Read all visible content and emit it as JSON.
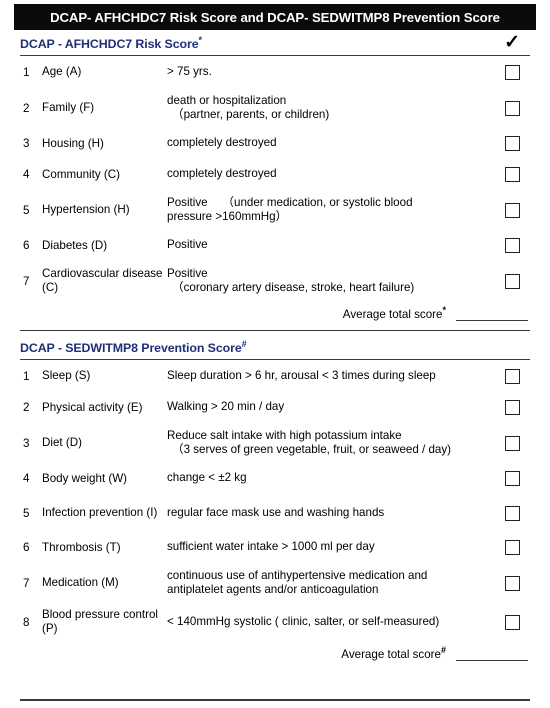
{
  "header": {
    "title": "DCAP- AFHCHDC7 Risk Score and DCAP- SEDWITMP8 Prevention Score"
  },
  "sections": [
    {
      "id": "risk",
      "title": "DCAP - AFHCHDC7 Risk Score",
      "marker": "*",
      "check_icon": "✓",
      "rows": [
        {
          "num": "1",
          "label": "Age (A)",
          "desc_line1": "> 75 yrs.",
          "desc_line2": ""
        },
        {
          "num": "2",
          "label": "Family  (F)",
          "desc_line1": "death or hospitalization",
          "desc_line2": "（partner, parents, or children)"
        },
        {
          "num": "3",
          "label": "Housing  (H)",
          "desc_line1": "completely destroyed",
          "desc_line2": ""
        },
        {
          "num": "4",
          "label": "Community (C)",
          "desc_line1": "completely destroyed",
          "desc_line2": ""
        },
        {
          "num": "5",
          "label": "Hypertension  (H)",
          "desc_line1": "Positive　 （under medication, or systolic blood",
          "desc_line2": "pressure  >160mmHg）"
        },
        {
          "num": "6",
          "label": "Diabetes  (D)",
          "desc_line1": "Positive",
          "desc_line2": ""
        },
        {
          "num": "7",
          "label": "Cardiovascular disease (C)",
          "desc_line1": "Positive",
          "desc_line2": "（coronary artery disease, stroke, heart failure)"
        }
      ],
      "average": {
        "label": "Average total score",
        "marker": "*",
        "value": ""
      }
    },
    {
      "id": "prevention",
      "title": "DCAP - SEDWITMP8 Prevention Score",
      "marker": "#",
      "check_icon": "",
      "rows": [
        {
          "num": "1",
          "label": "Sleep  (S)",
          "desc_line1": "Sleep duration > 6 hr,  arousal < 3 times during sleep",
          "desc_line2": ""
        },
        {
          "num": "2",
          "label": "Physical activity (E)",
          "desc_line1": "Walking > 20 min / day",
          "desc_line2": ""
        },
        {
          "num": "3",
          "label": "Diet (D)",
          "desc_line1": "Reduce salt intake with high potassium intake",
          "desc_line2": "（3 serves of green vegetable, fruit, or seaweed / day)"
        },
        {
          "num": "4",
          "label": "Body weight (W)",
          "desc_line1": "change < ±2 kg",
          "desc_line2": ""
        },
        {
          "num": "5",
          "label": "Infection prevention (I)",
          "desc_line1": "regular face mask use and washing hands",
          "desc_line2": ""
        },
        {
          "num": "6",
          "label": "Thrombosis (T)",
          "desc_line1": "sufficient water intake > 1000 ml per day",
          "desc_line2": ""
        },
        {
          "num": "7",
          "label": "Medication (M)",
          "desc_line1": "continuous use of antihypertensive medication and",
          "desc_line2": "antiplatelet agents and/or anticoagulation"
        },
        {
          "num": "8",
          "label": "Blood pressure control (P)",
          "desc_line1": "< 140mmHg systolic  ( clinic, salter, or self-measured)",
          "desc_line2": ""
        }
      ],
      "average": {
        "label": "Average total score",
        "marker": "#",
        "value": ""
      }
    }
  ],
  "colors": {
    "titlebar_bg": "#0a0a0a",
    "titlebar_text": "#ffffff",
    "section_title": "#1f2f7a",
    "rule": "#3a3a3a",
    "checkbox_border": "#222222"
  }
}
